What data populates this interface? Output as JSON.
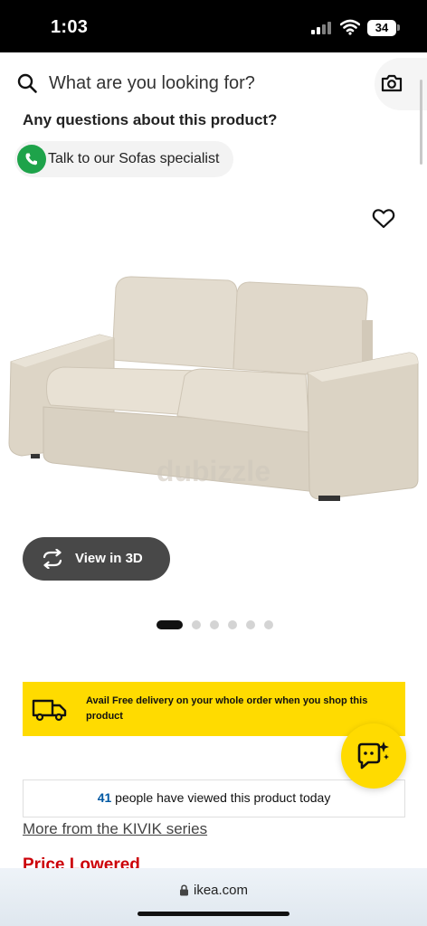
{
  "status_bar": {
    "time": "1:03",
    "battery": "34"
  },
  "search": {
    "placeholder": "What are you looking for?"
  },
  "support": {
    "question": "Any questions about this product?",
    "specialist_label": "Talk to our Sofas specialist"
  },
  "gallery": {
    "watermark": "dubizzle",
    "view_3d_label": "View in 3D",
    "image_count": 6,
    "active_index": 0
  },
  "delivery_banner": {
    "text": "Avail Free delivery on your whole order when you shop this product"
  },
  "viewers": {
    "count": "41",
    "text": " people have viewed this product today"
  },
  "series_link": "More from the KIVIK series",
  "price_label": "Price Lowered",
  "browser": {
    "url": "ikea.com"
  },
  "colors": {
    "ikea_yellow": "#ffdb00",
    "ikea_blue": "#0058a3",
    "price_red": "#cc0008",
    "phone_green": "#1ea34a"
  },
  "icons": [
    "search-icon",
    "camera-icon",
    "phone-icon",
    "heart-icon",
    "rotate-3d-icon",
    "truck-icon",
    "chat-sparkle-icon",
    "lock-icon"
  ]
}
